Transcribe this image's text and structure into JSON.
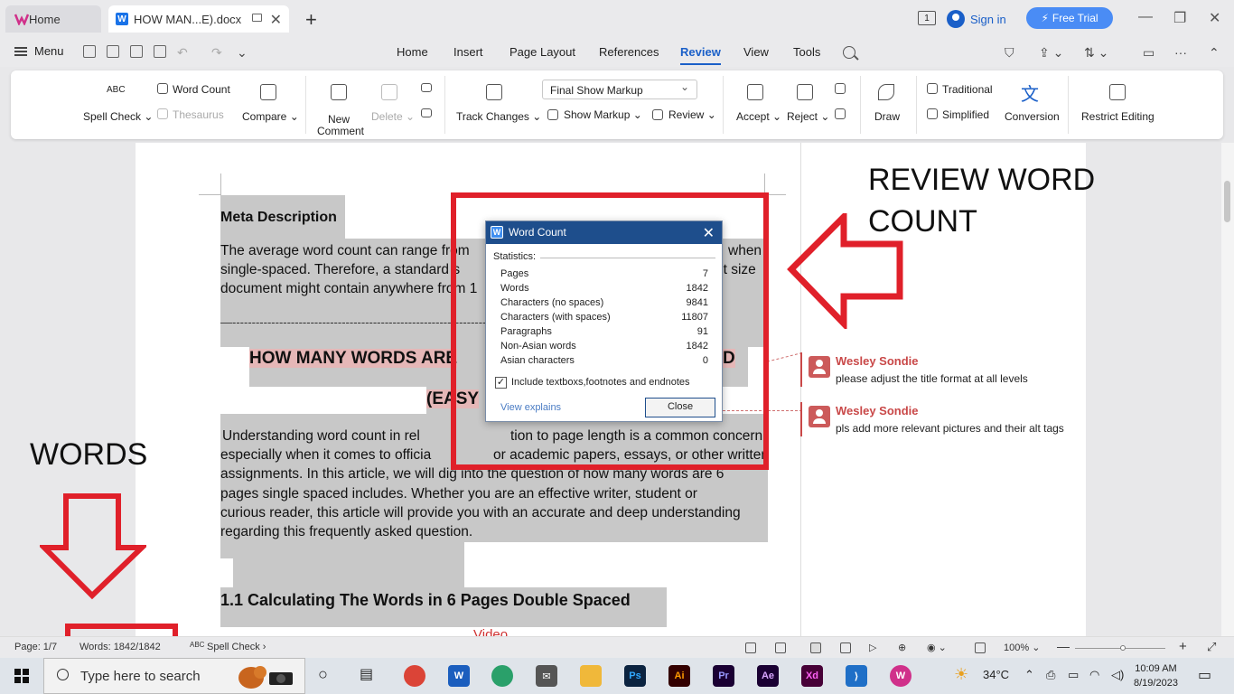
{
  "tabs": {
    "home_label": "Home",
    "doc_label": "HOW MAN...E).docx"
  },
  "titlebar": {
    "badge": "1",
    "signin_label": "Sign in",
    "free_trial_label": "Free Trial"
  },
  "menubar": {
    "menu_label": "Menu",
    "tabs": [
      "Home",
      "Insert",
      "Page Layout",
      "References",
      "Review",
      "View",
      "Tools"
    ],
    "active_tab": "Review"
  },
  "ribbon": {
    "spell_check_icon_text": "ABC",
    "spell_check": "Spell Check",
    "word_count": "Word Count",
    "thesaurus": "Thesaurus",
    "compare": "Compare",
    "new_comment_line1": "New",
    "new_comment_line2": "Comment",
    "delete": "Delete",
    "track_changes": "Track Changes",
    "markup_select": "Final Show Markup",
    "show_markup": "Show Markup",
    "review": "Review",
    "accept": "Accept",
    "reject": "Reject",
    "draw": "Draw",
    "traditional": "Traditional",
    "simplified": "Simplified",
    "conversion": "Conversion",
    "restrict_editing": "Restrict Editing"
  },
  "document": {
    "meta_heading": "Meta Description",
    "para1": "The average word count can range from ... when single-spaced. Therefore, a standard s... font size document might contain anywhere from 1",
    "para1_l1": "The average word count can range from",
    "para1_l1b": "when",
    "para1_l2": "single-spaced.  Therefore,  a  standard  s",
    "para1_l2b": "nt size",
    "para1_l3": "document might contain anywhere from 1",
    "dashes": "—-------------------------------------------------------------------------------------------------------------------------",
    "title_l1": "HOW MANY WORDS ARE",
    "title_l1b": "D",
    "title_l2": "(EASY",
    "body_l1": "Understanding word count in rel",
    "body_l1b": "tion to page length is a common concern",
    "body_l2": "especially when it comes to officia",
    "body_l2b": "or academic papers, essays, or other written",
    "body_l3": "assignments. In this article, we will dig into the question of how many words are 6",
    "body_l4": "pages single spaced includes. Whether you are an effective writer, student or",
    "body_l5": "curious reader, this article will provide you with an accurate and deep understanding",
    "body_l6": "regarding this frequently asked question.",
    "section_heading": "1.1   Calculating The Words in 6 Pages Double Spaced",
    "video_link": "Video"
  },
  "comments": [
    {
      "author": "Wesley Sondie",
      "text": "please adjust the title format at all levels"
    },
    {
      "author": "Wesley Sondie",
      "text": "pls add more relevant pictures and their alt tags"
    }
  ],
  "annotations": {
    "review_label_l1": "REVIEW WORD",
    "review_label_l2": "COUNT",
    "words_label": "WORDS",
    "annotation_color": "#e0202a"
  },
  "dialog": {
    "title": "Word Count",
    "statistics_label": "Statistics:",
    "rows": [
      {
        "label": "Pages",
        "value": "7"
      },
      {
        "label": "Words",
        "value": "1842"
      },
      {
        "label": "Characters (no spaces)",
        "value": "9841"
      },
      {
        "label": "Characters (with spaces)",
        "value": "11807"
      },
      {
        "label": "Paragraphs",
        "value": "91"
      },
      {
        "label": "Non-Asian words",
        "value": "1842"
      },
      {
        "label": "Asian characters",
        "value": "0"
      }
    ],
    "include_label": "Include textboxs,footnotes and endnotes",
    "include_checked": "✓",
    "view_explains": "View explains",
    "close_label": "Close"
  },
  "statusbar": {
    "page": "Page: 1/7",
    "words": "Words: 1842/1842",
    "spell_check": "Spell Check",
    "spell_icon": "ABC",
    "zoom": "100%"
  },
  "taskbar": {
    "search_placeholder": "Type here to search",
    "temperature": "34°C",
    "time": "10:09 AM",
    "date": "8/19/2023"
  }
}
